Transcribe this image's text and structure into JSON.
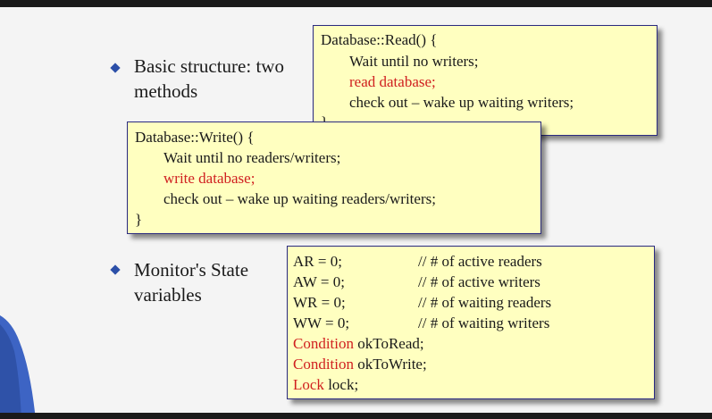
{
  "bullets": [
    {
      "lines": [
        "Basic structure: two",
        "methods"
      ]
    },
    {
      "lines": [
        "Monitor's State",
        "variables"
      ]
    }
  ],
  "read_box": {
    "header": "Database::Read() {",
    "line1": "Wait until no writers;",
    "line2": "read database;",
    "line3": "check out – wake up waiting writers;",
    "footer": "}"
  },
  "write_box": {
    "header": "Database::Write() {",
    "line1": "Wait until no readers/writers;",
    "line2": "write database;",
    "line3": "check out – wake up waiting readers/writers;",
    "footer": "}"
  },
  "state_box": {
    "vars": [
      {
        "code": "AR = 0;",
        "comment": "// # of active readers"
      },
      {
        "code": "AW = 0;",
        "comment": "// # of active writers"
      },
      {
        "code": "WR = 0;",
        "comment": "// # of waiting readers"
      },
      {
        "code": "WW = 0;",
        "comment": "// # of waiting writers"
      }
    ],
    "decls": [
      {
        "type": "Condition",
        "name": "okToRead;"
      },
      {
        "type": "Condition",
        "name": "okToWrite;"
      },
      {
        "type": "Lock",
        "name": "lock;"
      }
    ]
  },
  "colors": {
    "keyword": "#d02020",
    "box_bg": "#ffffc0",
    "bullet": "#2b4fa8"
  }
}
